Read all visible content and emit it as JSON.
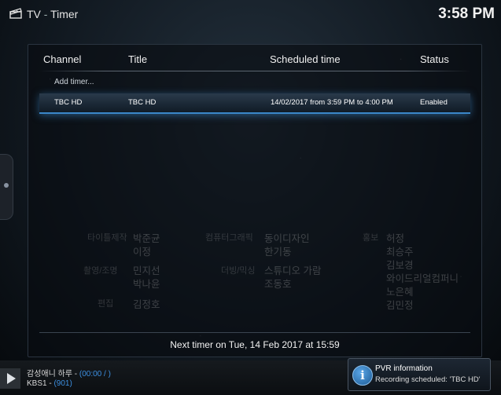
{
  "header": {
    "app_title": "TV",
    "separator": "-",
    "window_title": "Timer",
    "clock": "3:58 PM"
  },
  "table": {
    "columns": [
      "Channel",
      "Title",
      "Scheduled time",
      "Status"
    ],
    "add_timer_label": "Add timer...",
    "rows": [
      {
        "channel": "TBC HD",
        "title": "TBC HD",
        "scheduled": "14/02/2017 from 3:59 PM to 4:00 PM",
        "status": "Enabled"
      }
    ]
  },
  "next_timer": "Next timer on Tue, 14 Feb 2017 at 15:59",
  "now_playing": {
    "program": "감성애니 하루 -",
    "time": "(00:00 / )",
    "channel": "KBS1 -",
    "channel_number": "(901)"
  },
  "notification": {
    "title": "PVR information",
    "message": "Recording scheduled: 'TBC HD'"
  },
  "background_credits": {
    "role_1": "타이틀제작",
    "name_1a": "박준균",
    "name_1b": "이정",
    "role_2": "컴퓨터그래픽",
    "name_2a": "동이디자인",
    "name_2b": "한기동",
    "role_3": "홍보",
    "name_3a": "허정",
    "name_3b": "최승주",
    "name_3c": "김보경",
    "role_4": "촬영/조명",
    "name_4a": "민지선",
    "name_4b": "박나윤",
    "role_5": "더빙/믹싱",
    "name_5a": "스튜디오 가람",
    "name_5b": "조동호",
    "name_6a": "와이드리얼컴퍼니",
    "name_6b": "노은혜",
    "name_6c": "김민정",
    "role_7": "편집",
    "name_7": "김정호"
  },
  "colors": {
    "accent_blue": "#3b87c9",
    "link_blue": "#3c8fe0"
  },
  "icons": {
    "app": "clapperboard-icon",
    "notification": "info-icon",
    "play": "play-icon"
  }
}
